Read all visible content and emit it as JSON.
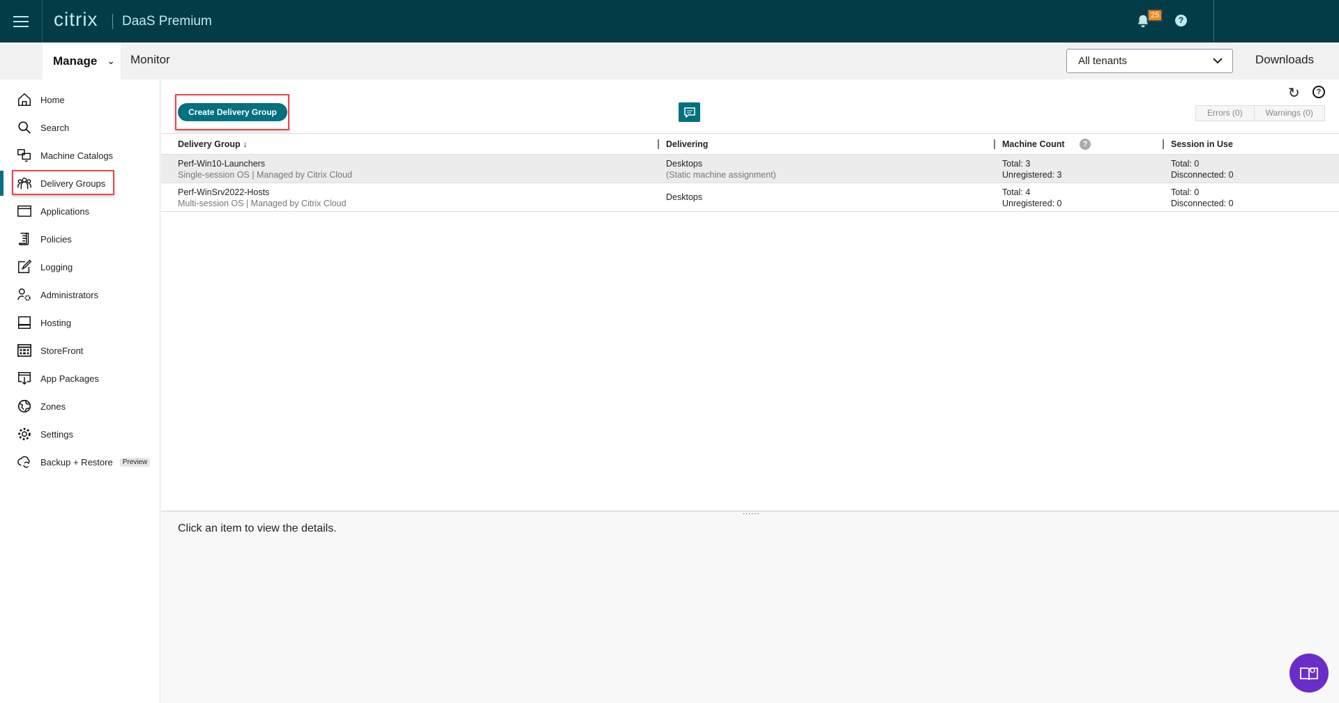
{
  "header": {
    "logo": "citrix",
    "product": "DaaS Premium",
    "notification_count": "25",
    "help": "?"
  },
  "subnav": {
    "manage": "Manage",
    "monitor": "Monitor",
    "tenant_select": "All tenants",
    "downloads": "Downloads"
  },
  "sidebar": {
    "items": [
      {
        "label": "Home",
        "icon": "home-icon"
      },
      {
        "label": "Search",
        "icon": "search-icon"
      },
      {
        "label": "Machine Catalogs",
        "icon": "machine-catalogs-icon"
      },
      {
        "label": "Delivery Groups",
        "icon": "delivery-groups-icon"
      },
      {
        "label": "Applications",
        "icon": "applications-icon"
      },
      {
        "label": "Policies",
        "icon": "policies-icon"
      },
      {
        "label": "Logging",
        "icon": "logging-icon"
      },
      {
        "label": "Administrators",
        "icon": "administrators-icon"
      },
      {
        "label": "Hosting",
        "icon": "hosting-icon"
      },
      {
        "label": "StoreFront",
        "icon": "storefront-icon"
      },
      {
        "label": "App Packages",
        "icon": "app-packages-icon"
      },
      {
        "label": "Zones",
        "icon": "zones-icon"
      },
      {
        "label": "Settings",
        "icon": "settings-icon"
      },
      {
        "label": "Backup + Restore",
        "icon": "backup-restore-icon",
        "badge": "Preview"
      }
    ],
    "active": "Delivery Groups"
  },
  "toolbar": {
    "create": "Create Delivery Group",
    "errors": "Errors (0)",
    "warnings": "Warnings (0)"
  },
  "table": {
    "headers": [
      "Delivery Group ↓",
      "Delivering",
      "Machine Count",
      "Session in Use"
    ],
    "rows": [
      {
        "name": "Perf-Win10-Launchers",
        "desc": "Single-session OS | Managed by Citrix Cloud",
        "delivering": "Desktops",
        "delivering_sub": "(Static machine assignment)",
        "total": "Total: 3",
        "unregistered": "Unregistered: 3",
        "sessions": "Total: 0",
        "disconnected": "Disconnected: 0"
      },
      {
        "name": "Perf-WinSrv2022-Hosts",
        "desc": "Multi-session OS | Managed by Citrix Cloud",
        "delivering": "Desktops",
        "delivering_sub": "",
        "total": "Total: 4",
        "unregistered": "Unregistered: 0",
        "sessions": "Total: 0",
        "disconnected": "Disconnected: 0"
      }
    ]
  },
  "details": {
    "placeholder": "Click an item to view the details.",
    "grip": "......"
  },
  "colors": {
    "topbar": "#033c47",
    "accent": "#02707f",
    "badge": "#f0891c",
    "fab": "#6b2dc7"
  }
}
